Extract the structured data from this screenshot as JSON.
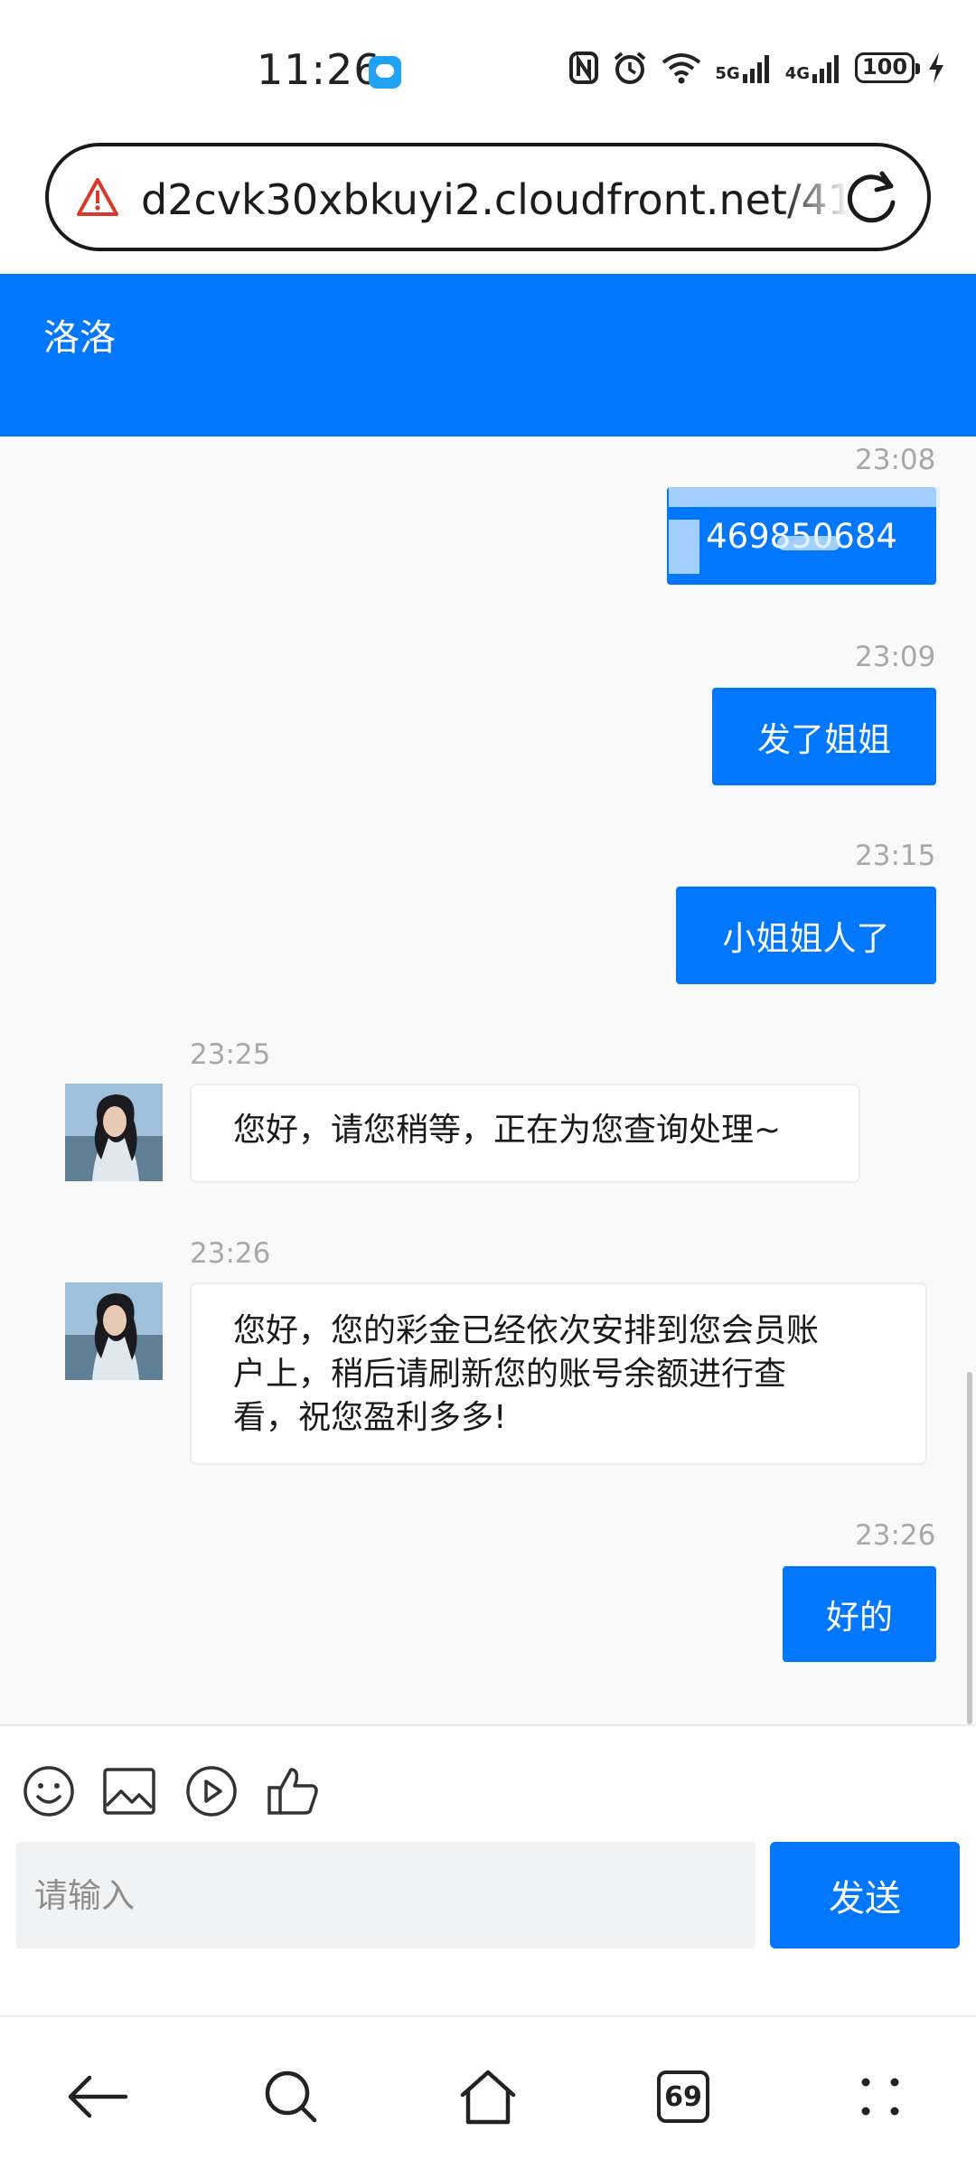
{
  "status_bar": {
    "time": "11:26",
    "network_1": "5G",
    "network_2": "4G",
    "battery": "100"
  },
  "browser": {
    "url": "d2cvk30xbkuyi2.cloudfront.net/41"
  },
  "chat": {
    "title": "洛洛",
    "messages": [
      {
        "time": "23:08",
        "side": "out",
        "text": "469850684"
      },
      {
        "time": "23:09",
        "side": "out",
        "text": "发了姐姐"
      },
      {
        "time": "23:15",
        "side": "out",
        "text": "小姐姐人了"
      },
      {
        "time": "23:25",
        "side": "in",
        "text": "您好，请您稍等，正在为您查询处理~"
      },
      {
        "time": "23:26",
        "side": "in",
        "lines": [
          "您好，您的彩金已经依次安排到您会员账",
          "户上，稍后请刷新您的账号余额进行查",
          "看，祝您盈利多多!"
        ]
      },
      {
        "time": "23:26",
        "side": "out",
        "text": "好的"
      }
    ]
  },
  "composer": {
    "placeholder": "请输入",
    "send_label": "发送"
  },
  "nav": {
    "tab_count": "69"
  },
  "colors": {
    "accent": "#0177fe",
    "chat_bg": "#f9f9f9",
    "timestamp": "#a8a8a8"
  }
}
